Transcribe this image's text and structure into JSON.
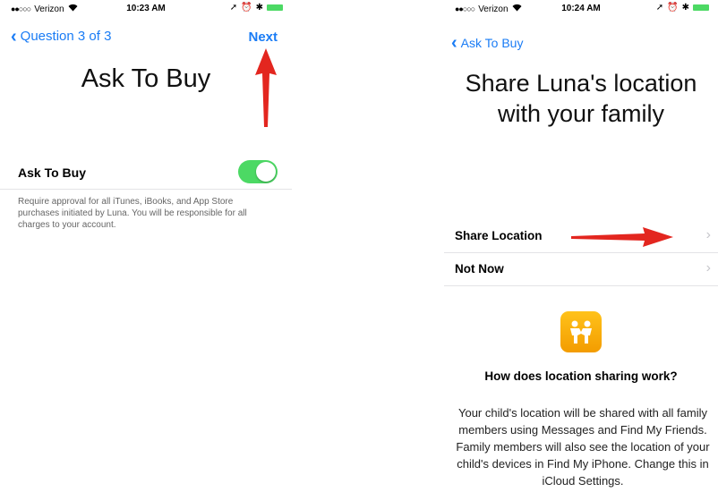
{
  "left": {
    "status": {
      "carrier": "Verizon",
      "time": "10:23 AM"
    },
    "nav": {
      "back_label": "Question 3 of 3",
      "next_label": "Next"
    },
    "title": "Ask To Buy",
    "setting": {
      "label": "Ask To Buy",
      "enabled": true
    },
    "footer": "Require approval for all iTunes, iBooks, and App Store purchases initiated by Luna. You will be responsible for all charges to your account."
  },
  "right": {
    "status": {
      "carrier": "Verizon",
      "time": "10:24 AM"
    },
    "nav": {
      "back_label": "Ask To Buy"
    },
    "title": "Share Luna's location with your family",
    "rows": [
      {
        "label": "Share Location"
      },
      {
        "label": "Not Now"
      }
    ],
    "info_heading": "How does location sharing work?",
    "info_body": "Your child's location will be shared with all family members using Messages and Find My Friends. Family members will also see the location of your child's devices in Find My iPhone. Change this in iCloud Settings."
  },
  "colors": {
    "ios_blue": "#1a7cf5",
    "toggle_green": "#4cd964",
    "annotation_red": "#e3261f",
    "icon_yellow": "#f7b10c"
  },
  "icons": [
    "signal-dots-icon",
    "wifi-icon",
    "location-arrow-icon",
    "alarm-icon",
    "bluetooth-icon",
    "battery-icon",
    "chevron-left-icon",
    "chevron-right-icon",
    "find-my-friends-icon",
    "red-arrow-annotation"
  ]
}
